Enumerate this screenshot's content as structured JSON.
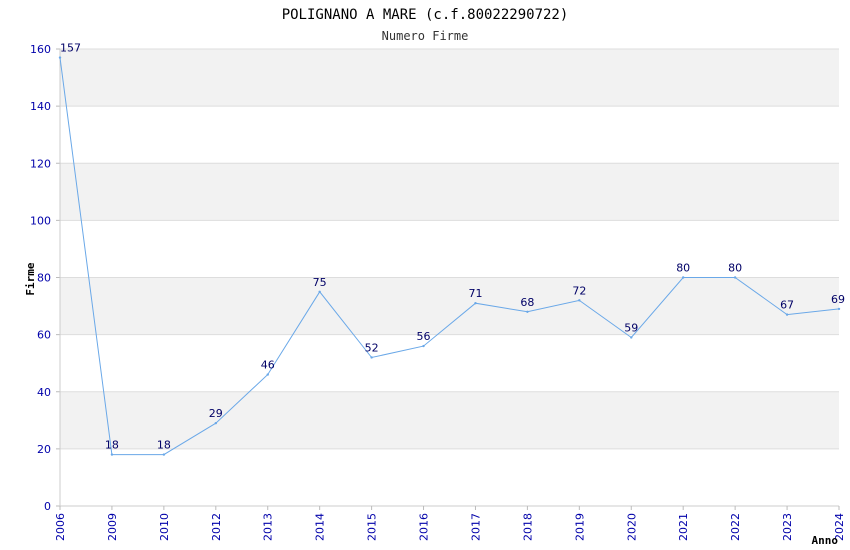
{
  "chart_data": {
    "type": "line",
    "title": "POLIGNANO A MARE (c.f.80022290722)",
    "subtitle": "Numero Firme",
    "xlabel": "Anno",
    "ylabel": "Firme",
    "ylim": [
      0,
      160
    ],
    "yticks": [
      0,
      20,
      40,
      60,
      80,
      100,
      120,
      140,
      160
    ],
    "categories": [
      "2006",
      "2009",
      "2010",
      "2012",
      "2013",
      "2014",
      "2015",
      "2016",
      "2017",
      "2018",
      "2019",
      "2020",
      "2021",
      "2022",
      "2023",
      "2024"
    ],
    "values": [
      157,
      18,
      18,
      29,
      46,
      75,
      52,
      56,
      71,
      68,
      72,
      59,
      80,
      80,
      67,
      69
    ],
    "grid": true,
    "colors": {
      "line": "#6aa8e8",
      "band": "#f2f2f2",
      "grid": "#dddddd",
      "tick": "#0000aa",
      "label": "#000066"
    }
  }
}
